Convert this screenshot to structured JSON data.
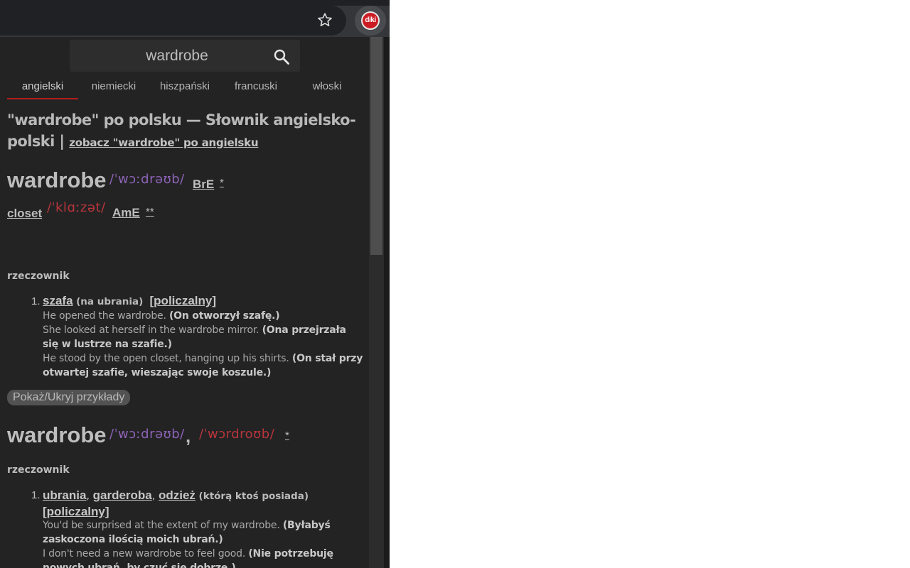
{
  "search": {
    "value": "wardrobe"
  },
  "tabs": [
    "angielski",
    "niemiecki",
    "hiszpański",
    "francuski",
    "włoski"
  ],
  "page_title": {
    "text": "\"wardrobe\" po polsku — Słownik angielsko-polski |",
    "link": "zobacz \"wardrobe\" po angielsku"
  },
  "entry1": {
    "headword": "wardrobe",
    "ipa_br": "/ˈwɔːdrəʊb/",
    "variety_br": "BrE",
    "star_br": "*",
    "alt_word": "closet",
    "ipa_am": "/ˈklɑːzət/",
    "variety_am": "AmE",
    "star_am": "**",
    "pos": "rzeczownik",
    "sense_num": "1.",
    "sense_word": "szafa",
    "sense_note": "(na ubrania)",
    "sense_tag": "[policzalny]",
    "examples": [
      {
        "en": "He opened the wardrobe.",
        "pl": "(On otworzył szafę.)"
      },
      {
        "en": "She looked at herself in the wardrobe mirror.",
        "pl": "(Ona przejrzała się w lustrze na szafie.)"
      },
      {
        "en": "He stood by the open closet, hanging up his shirts.",
        "pl": "(On stał przy otwartej szafie, wieszając swoje koszule.)"
      }
    ]
  },
  "toggle_examples": "Pokaż/Ukryj przykłady",
  "entry2": {
    "headword": "wardrobe",
    "ipa_br": "/ˈwɔːdrəʊb/",
    "comma": ",",
    "ipa_am": "/ˈwɔrdroʊb/",
    "star": "*",
    "pos": "rzeczownik",
    "sense_num": "1.",
    "w1": "ubrania",
    "w2": "garderoba",
    "w3": "odzież",
    "sep": ",",
    "sense_note": "(którą ktoś posiada)",
    "sense_tag": "[policzalny]",
    "examples": [
      {
        "en": "You'd be surprised at the extent of my wardrobe.",
        "pl": "(Byłabyś zaskoczona ilością moich ubrań.)"
      },
      {
        "en": "I don't need a new wardrobe to feel good.",
        "pl": "(Nie potrzebuję nowych ubrań, by czuć się dobrze.)"
      }
    ]
  },
  "background": {
    "fragment": "fi"
  },
  "icons": {
    "star": "star-outline-icon",
    "extension": "diki-extension-icon",
    "search": "magnifier-icon"
  },
  "extension_label": "diki",
  "colors": {
    "popup_bg": "#232324",
    "accent_red": "#b71c1c",
    "ipa_purple": "#8e63b7",
    "ipa_red": "#b8353b"
  }
}
